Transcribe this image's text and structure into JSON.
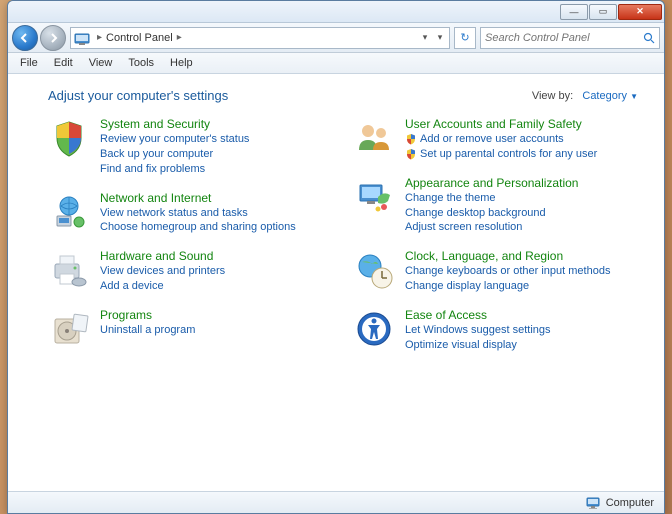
{
  "titlebar": {
    "min": "—",
    "max": "▭",
    "close": "✕"
  },
  "nav": {
    "back": "←",
    "fwd": "→",
    "breadcrumb_text": "Control Panel",
    "refresh": "↻"
  },
  "search": {
    "placeholder": "Search Control Panel"
  },
  "menu": {
    "file": "File",
    "edit": "Edit",
    "view": "View",
    "tools": "Tools",
    "help": "Help"
  },
  "heading": "Adjust your computer's settings",
  "viewby_label": "View by:",
  "viewby_value": "Category",
  "left": [
    {
      "title": "System and Security",
      "links": [
        "Review your computer's status",
        "Back up your computer",
        "Find and fix problems"
      ]
    },
    {
      "title": "Network and Internet",
      "links": [
        "View network status and tasks",
        "Choose homegroup and sharing options"
      ]
    },
    {
      "title": "Hardware and Sound",
      "links": [
        "View devices and printers",
        "Add a device"
      ]
    },
    {
      "title": "Programs",
      "links": [
        "Uninstall a program"
      ]
    }
  ],
  "right": [
    {
      "title": "User Accounts and Family Safety",
      "shielded": [
        true,
        true
      ],
      "links": [
        "Add or remove user accounts",
        "Set up parental controls for any user"
      ]
    },
    {
      "title": "Appearance and Personalization",
      "links": [
        "Change the theme",
        "Change desktop background",
        "Adjust screen resolution"
      ]
    },
    {
      "title": "Clock, Language, and Region",
      "links": [
        "Change keyboards or other input methods",
        "Change display language"
      ]
    },
    {
      "title": "Ease of Access",
      "links": [
        "Let Windows suggest settings",
        "Optimize visual display"
      ]
    }
  ],
  "status": "Computer"
}
